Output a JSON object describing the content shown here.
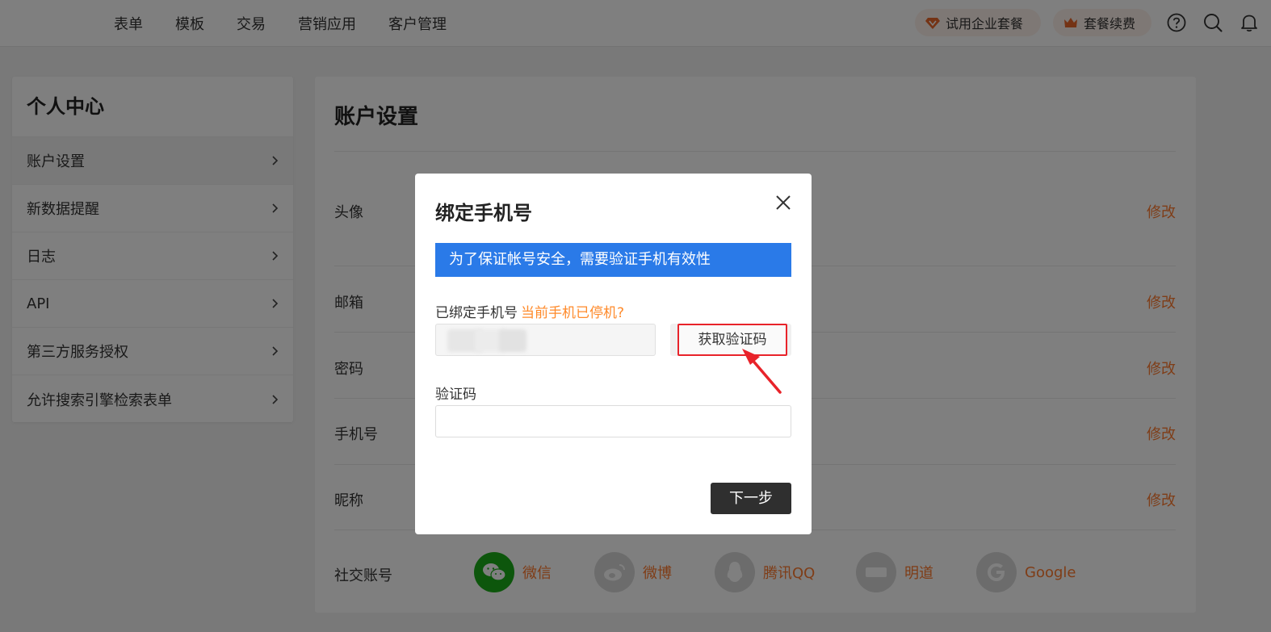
{
  "topnav": {
    "items": [
      "表单",
      "模板",
      "交易",
      "营销应用",
      "客户管理"
    ],
    "trial_label": "试用企业套餐",
    "renew_label": "套餐续费",
    "icons": [
      "help-icon",
      "search-icon",
      "bell-icon"
    ]
  },
  "sidebar": {
    "title": "个人中心",
    "items": [
      {
        "label": "账户设置"
      },
      {
        "label": "新数据提醒"
      },
      {
        "label": "日志"
      },
      {
        "label": "API"
      },
      {
        "label": "第三方服务授权"
      },
      {
        "label": "允许搜索引擎检索表单"
      }
    ]
  },
  "main": {
    "title": "账户设置",
    "rows": [
      {
        "label": "头像",
        "action": "修改"
      },
      {
        "label": "邮箱",
        "action": "修改"
      },
      {
        "label": "密码",
        "action": "修改"
      },
      {
        "label": "手机号",
        "action": "修改"
      },
      {
        "label": "昵称",
        "action": "修改"
      }
    ],
    "social_label": "社交账号",
    "social": [
      {
        "name": "微信",
        "color": "#1aad19"
      },
      {
        "name": "微博",
        "color": "#d8d8d8"
      },
      {
        "name": "腾讯QQ",
        "color": "#d8d8d8"
      },
      {
        "name": "明道",
        "color": "#d8d8d8"
      },
      {
        "name": "Google",
        "color": "#d8d8d8"
      }
    ]
  },
  "dialog": {
    "title": "绑定手机号",
    "banner": "为了保证帐号安全，需要验证手机有效性",
    "phone_label": "已绑定手机号",
    "phone_warning": "当前手机已停机?",
    "get_code_label": "获取验证码",
    "code_label": "验证码",
    "code_value": "",
    "next_label": "下一步"
  },
  "colors": {
    "accent_orange": "#ff7a2e",
    "banner_blue": "#2a7ae8",
    "highlight_red": "#e8232a"
  }
}
